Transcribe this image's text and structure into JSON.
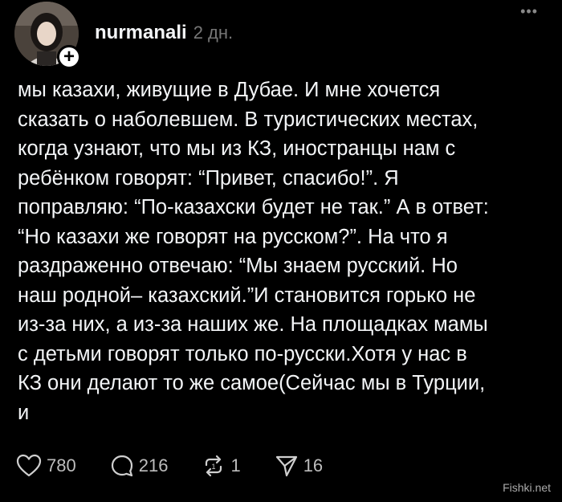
{
  "post": {
    "username": "nurmanali",
    "timestamp": "2 дн.",
    "text": "мы казахи, живущие в Дубае. И мне хочется\nсказать о наболевшем. В туристических местах,\nкогда узнают, что мы из КЗ, иностранцы нам с\nребёнком говорят: “Привет, спасибо!”. Я\nпоправляю: “По-казахски будет не так.” А в ответ:\n“Но казахи же говорят на русском?”. На что я\nраздраженно отвечаю: “Мы знаем русский. Но\nнаш родной– казахский.”И становится горько не\nиз-за них, а из-за наших же. На площадках мамы\nс детьми говорят только по-русски.Хотя у нас в\nКЗ они делают то же самое(Сейчас мы в Турции,\nи",
    "follow_symbol": "+",
    "more_symbol": "•••"
  },
  "actions": {
    "likes": "780",
    "comments": "216",
    "reposts": "1",
    "shares": "16"
  },
  "icons": {
    "like": "heart-icon",
    "comment": "comment-bubble-icon",
    "repost": "repost-icon",
    "share": "send-icon",
    "more": "more-options-icon"
  },
  "watermark": "Fishki.net",
  "colors": {
    "background": "#000000",
    "text": "#f3f5f7",
    "muted": "#777777"
  }
}
